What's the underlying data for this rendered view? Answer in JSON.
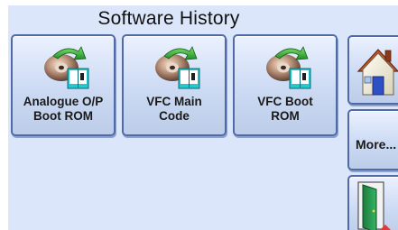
{
  "title": "Software History",
  "buttons": [
    {
      "line1": "Analogue O/P",
      "line2": "Boot ROM",
      "icon": "software-disc-icon"
    },
    {
      "line1": "VFC Main",
      "line2": "Code",
      "icon": "software-disc-icon"
    },
    {
      "line1": "VFC Boot",
      "line2": "ROM",
      "icon": "software-disc-icon"
    }
  ],
  "side": {
    "home_icon": "home-icon",
    "more_label": "More...",
    "exit_icon": "exit-door-icon"
  },
  "colors": {
    "screen_background": "#dbe6fa",
    "button_border": "#4f6aa6",
    "disc": "#c9a38a",
    "arrow": "#27a12e",
    "book": "#22c9cf",
    "house_roof": "#c0572c",
    "house_door": "#2f4fc4"
  }
}
